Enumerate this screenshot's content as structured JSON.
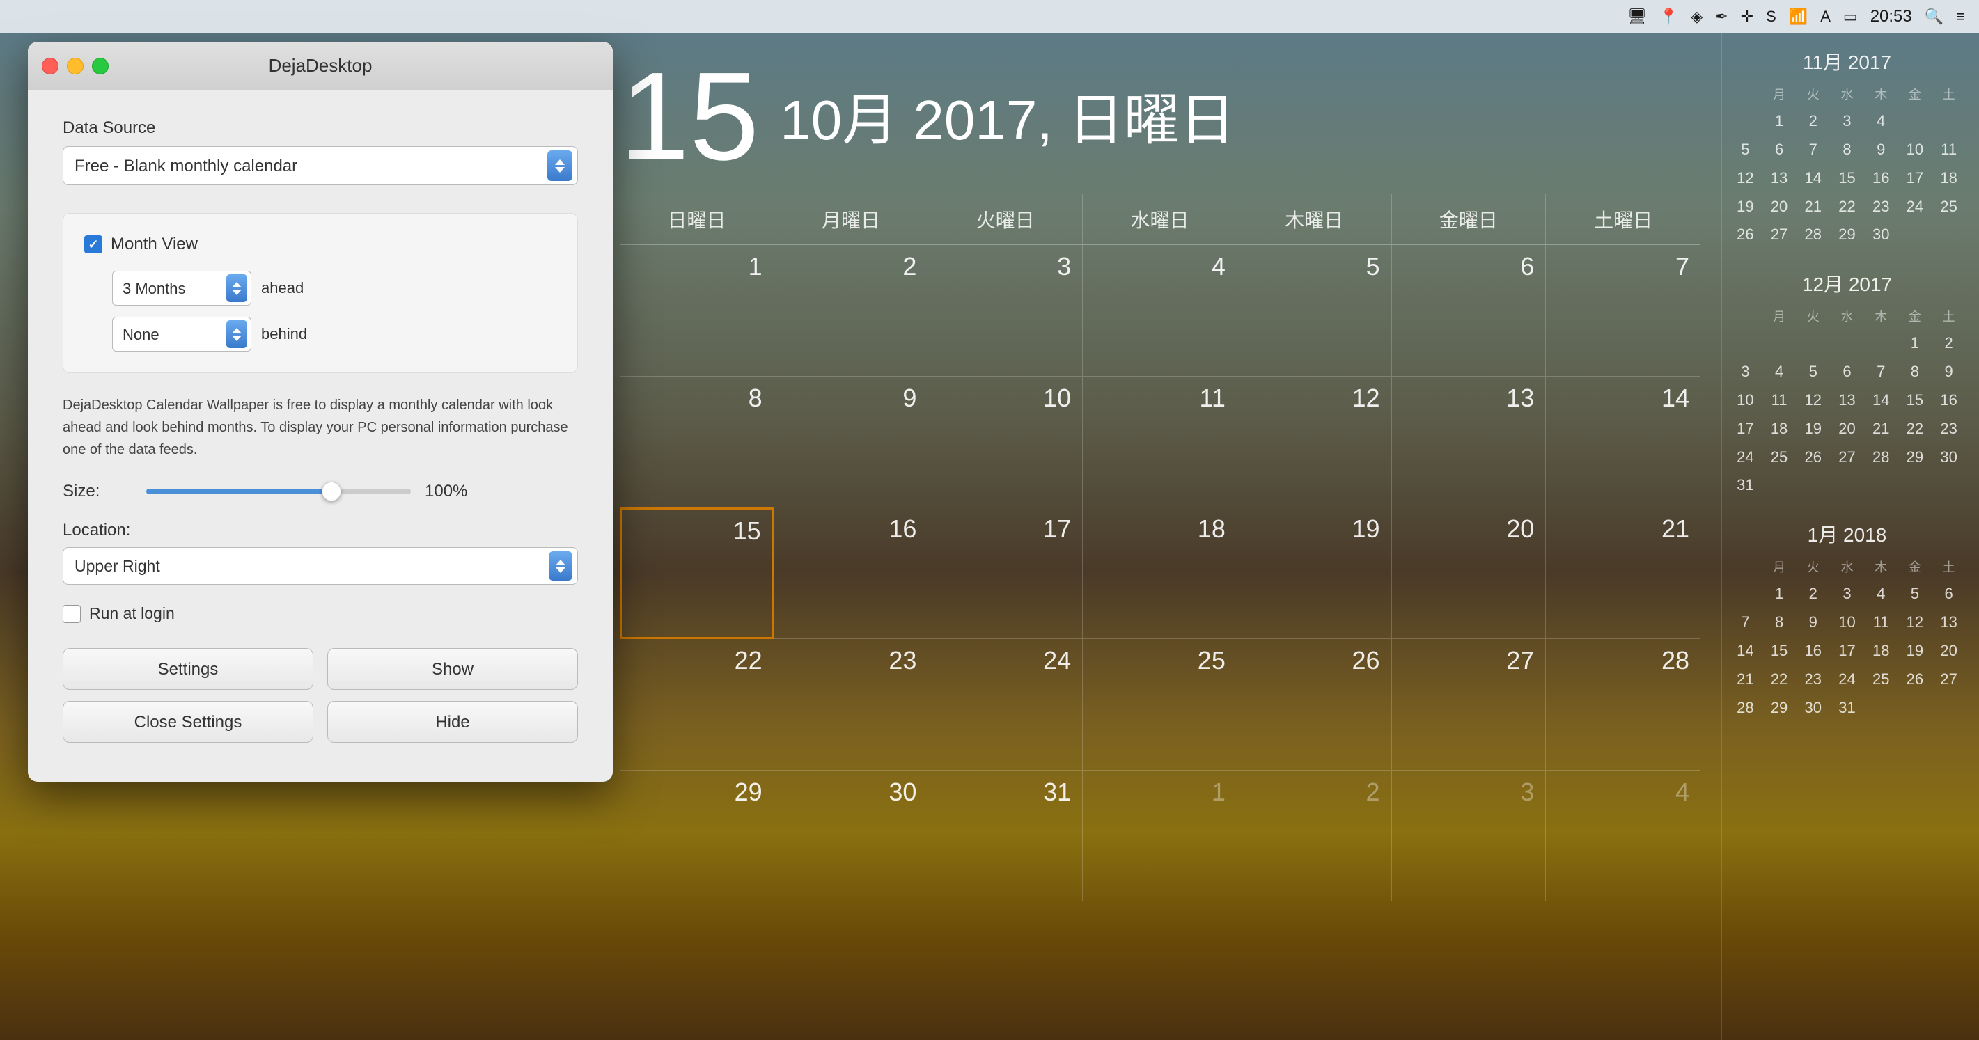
{
  "menubar": {
    "time": "20:53"
  },
  "panel": {
    "title": "DejaDesktop",
    "data_source_label": "Data Source",
    "data_source_value": "Free - Blank monthly calendar",
    "month_view_label": "Month View",
    "months_ahead_value": "3 Months",
    "ahead_label": "ahead",
    "none_value": "None",
    "behind_label": "behind",
    "info_text": "DejaDesktop Calendar Wallpaper is free to display a monthly calendar with look ahead and look behind months. To display your PC personal information purchase one of the data feeds.",
    "size_label": "Size:",
    "size_percent": "100%",
    "location_label": "Location:",
    "location_value": "Upper Right",
    "run_login_label": "Run at login",
    "btn_settings": "Settings",
    "btn_show": "Show",
    "btn_close_settings": "Close Settings",
    "btn_hide": "Hide"
  },
  "calendar": {
    "day_number": "15",
    "month_year": "10月 2017, 日曜日",
    "day_headers": [
      "日曜日",
      "月曜日",
      "火曜日",
      "水曜日",
      "木曜日",
      "金曜日",
      "土曜日"
    ],
    "weeks": [
      [
        {
          "num": "1",
          "other": false
        },
        {
          "num": "2",
          "other": false
        },
        {
          "num": "3",
          "other": false
        },
        {
          "num": "4",
          "other": false
        },
        {
          "num": "5",
          "other": false
        },
        {
          "num": "6",
          "other": false
        },
        {
          "num": "7",
          "other": false
        }
      ],
      [
        {
          "num": "8",
          "other": false
        },
        {
          "num": "9",
          "other": false
        },
        {
          "num": "10",
          "other": false
        },
        {
          "num": "11",
          "other": false
        },
        {
          "num": "12",
          "other": false
        },
        {
          "num": "13",
          "other": false
        },
        {
          "num": "14",
          "other": false
        }
      ],
      [
        {
          "num": "15",
          "other": false,
          "today": true
        },
        {
          "num": "16",
          "other": false
        },
        {
          "num": "17",
          "other": false
        },
        {
          "num": "18",
          "other": false
        },
        {
          "num": "19",
          "other": false
        },
        {
          "num": "20",
          "other": false
        },
        {
          "num": "21",
          "other": false
        }
      ],
      [
        {
          "num": "22",
          "other": false
        },
        {
          "num": "23",
          "other": false
        },
        {
          "num": "24",
          "other": false
        },
        {
          "num": "25",
          "other": false
        },
        {
          "num": "26",
          "other": false
        },
        {
          "num": "27",
          "other": false
        },
        {
          "num": "28",
          "other": false
        }
      ],
      [
        {
          "num": "29",
          "other": false
        },
        {
          "num": "30",
          "other": false
        },
        {
          "num": "31",
          "other": false
        },
        {
          "num": "1",
          "other": true
        },
        {
          "num": "2",
          "other": true
        },
        {
          "num": "3",
          "other": true
        },
        {
          "num": "4",
          "other": true
        }
      ]
    ]
  },
  "mini_calendars": [
    {
      "title": "11月 2017",
      "headers": [
        "",
        "月",
        "火",
        "水",
        "木",
        "金",
        "土"
      ],
      "weeks": [
        [
          "",
          "1",
          "2",
          "3",
          "4",
          "",
          ""
        ],
        [
          "5",
          "6",
          "7",
          "8",
          "9",
          "10",
          "11"
        ],
        [
          "12",
          "13",
          "14",
          "15",
          "16",
          "17",
          "18"
        ],
        [
          "19",
          "20",
          "21",
          "22",
          "23",
          "24",
          "25"
        ],
        [
          "26",
          "27",
          "28",
          "29",
          "30",
          "",
          ""
        ]
      ]
    },
    {
      "title": "12月 2017",
      "headers": [
        "",
        "月",
        "火",
        "水",
        "木",
        "金",
        "土"
      ],
      "weeks": [
        [
          "",
          "",
          "",
          "",
          "",
          "1",
          "2"
        ],
        [
          "3",
          "4",
          "5",
          "6",
          "7",
          "8",
          "9"
        ],
        [
          "10",
          "11",
          "12",
          "13",
          "14",
          "15",
          "16"
        ],
        [
          "17",
          "18",
          "19",
          "20",
          "21",
          "22",
          "23"
        ],
        [
          "24",
          "25",
          "26",
          "27",
          "28",
          "29",
          "30"
        ],
        [
          "31",
          "",
          "",
          "",
          "",
          "",
          ""
        ]
      ]
    },
    {
      "title": "1月 2018",
      "headers": [
        "",
        "月",
        "火",
        "水",
        "木",
        "金",
        "土"
      ],
      "weeks": [
        [
          "",
          "1",
          "2",
          "3",
          "4",
          "5",
          "6"
        ],
        [
          "7",
          "8",
          "9",
          "10",
          "11",
          "12",
          "13"
        ],
        [
          "14",
          "15",
          "16",
          "17",
          "18",
          "19",
          "20"
        ],
        [
          "21",
          "22",
          "23",
          "24",
          "25",
          "26",
          "27"
        ],
        [
          "28",
          "29",
          "30",
          "31",
          "",
          "",
          ""
        ]
      ]
    }
  ]
}
